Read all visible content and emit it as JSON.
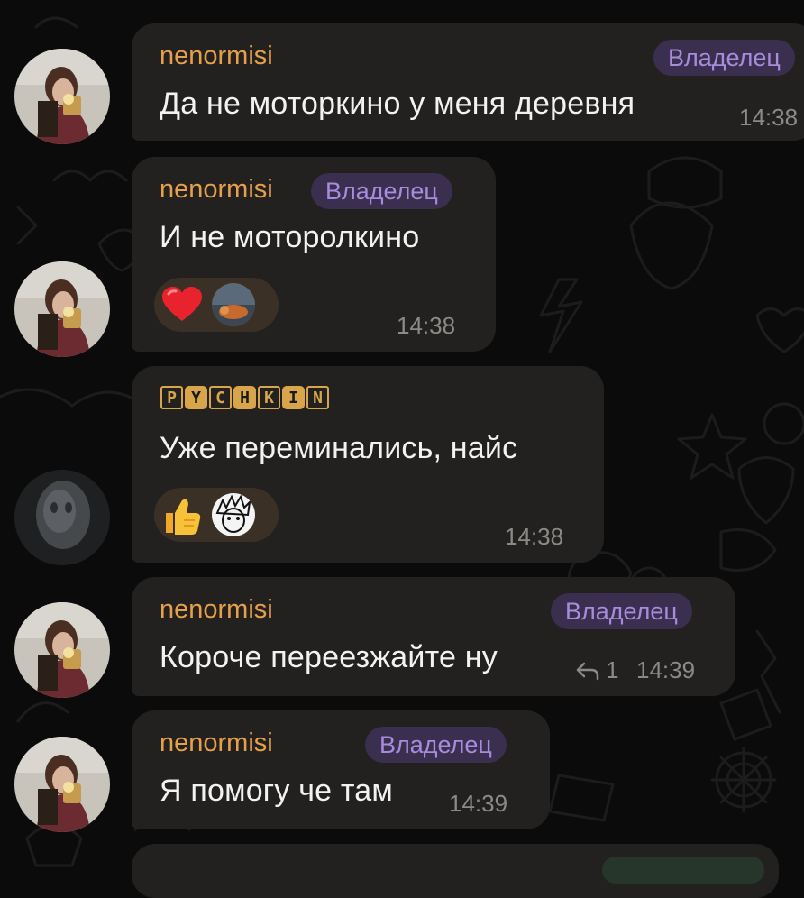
{
  "colors": {
    "background": "#0b0b0b",
    "bubble": "#222120",
    "sender_name": "#e7a04a",
    "badge_bg": "#3a2f4e",
    "badge_text": "#a88bdc",
    "message_text": "#f2f2f2",
    "timestamp": "#8a8a86",
    "reaction_bg": "#3b3025"
  },
  "messages": [
    {
      "sender": "nenormisi",
      "badge": "Владелец",
      "text": "Да не моторкино у меня деревня",
      "time": "14:38"
    },
    {
      "sender": "nenormisi",
      "badge": "Владелец",
      "text": "И не моторолкино",
      "time": "14:38",
      "reactions": [
        {
          "emoji": "❤️",
          "icon": "red-heart-icon"
        }
      ]
    },
    {
      "sender": "PYCHKIN",
      "sender_letters": [
        "P",
        "Y",
        "C",
        "H",
        "K",
        "I",
        "N"
      ],
      "text": "Уже переминались, найс",
      "time": "14:38",
      "reactions": [
        {
          "emoji": "👍",
          "icon": "thumbs-up-icon"
        }
      ]
    },
    {
      "sender": "nenormisi",
      "badge": "Владелец",
      "text": "Короче переезжайте ну",
      "time": "14:39",
      "reply_count": "1",
      "reply_icon": "reply-arrow-icon"
    },
    {
      "sender": "nenormisi",
      "badge": "Владелец",
      "text": "Я помогу че там",
      "time": "14:39"
    }
  ]
}
